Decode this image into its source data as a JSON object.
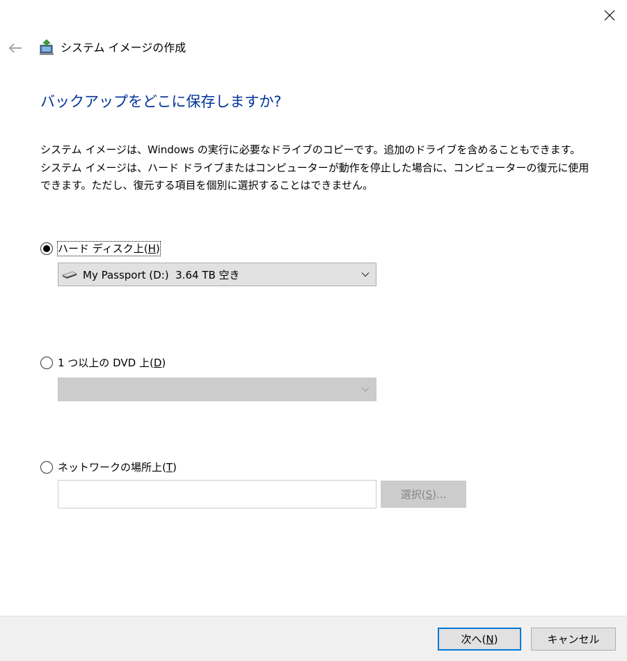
{
  "window": {
    "title": "システム イメージの作成",
    "close_icon": "close-icon",
    "back_icon": "back-arrow-icon",
    "app_icon": "system-image-backup-icon"
  },
  "heading": "バックアップをどこに保存しますか?",
  "description": [
    "システム イメージは、Windows の実行に必要なドライブのコピーです。追加のドライブを含めることもできます。",
    "システム イメージは、ハード ドライブまたはコンピューターが動作を停止した場合に、コンピューターの復元に使用",
    "できます。ただし、復元する項目を個別に選択することはできません。"
  ],
  "options": {
    "hard_disk": {
      "label": "ハード ディスク上",
      "accel_open": "(",
      "accel": "H",
      "accel_close": ")",
      "checked": true,
      "selected_value": "My Passport (D:)  3.64 TB 空き",
      "value_icon": "hard-drive-icon"
    },
    "dvd": {
      "label": "1 つ以上の DVD 上",
      "accel_open": "(",
      "accel": "D",
      "accel_close": ")",
      "checked": false,
      "selected_value": ""
    },
    "network": {
      "label": "ネットワークの場所上",
      "accel_open": "(",
      "accel": "T",
      "accel_close": ")",
      "checked": false,
      "input_value": "",
      "select_button": {
        "label": "選択",
        "accel_open": "(",
        "accel": "S",
        "accel_close": ")...",
        "enabled": false
      }
    }
  },
  "footer": {
    "next": {
      "label": "次へ",
      "accel_open": "(",
      "accel": "N",
      "accel_close": ")"
    },
    "cancel": {
      "label": "キャンセル"
    }
  },
  "colors": {
    "heading": "#003399",
    "primary_border": "#0078d7",
    "footer_bg": "#f0f0f0"
  }
}
